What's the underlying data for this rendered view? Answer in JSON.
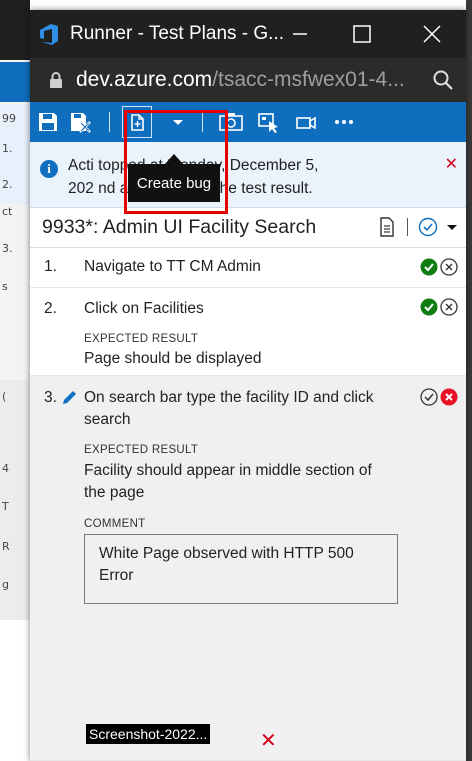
{
  "window": {
    "title": "Runner - Test Plans - G...",
    "url_host": "dev.azure.com",
    "url_path": "/tsacc-msfwex01-4..."
  },
  "toolbar": {
    "tooltip": "Create bug"
  },
  "info_bar": {
    "line1": "Acti       topped at Monday, December 5,",
    "line2": "202       nd attached with the test result."
  },
  "test_case": {
    "title": "9933*: Admin UI Facility Search"
  },
  "steps": [
    {
      "number": "1.",
      "action_line1": "Navigate to TT CM Admin",
      "status": "passed"
    },
    {
      "number": "2.",
      "action_line1": "Click on Facilities",
      "expected_label": "EXPECTED RESULT",
      "expected_line1": "Page should be displayed",
      "status": "passed"
    },
    {
      "number": "3.",
      "action_line1": "On search bar type the facility ID and click",
      "action_line2": "search",
      "expected_label": "EXPECTED RESULT",
      "expected_line1": "Facility should appear in middle section of",
      "expected_line2": "the page",
      "comment_label": "COMMENT",
      "comment_line1": "White Page observed with HTTP 500",
      "comment_line2": "Error",
      "attachment": "Screenshot-2022...",
      "status": "failed"
    }
  ],
  "background_window": {
    "rows": [
      "99",
      "1.",
      "2.",
      "ct",
      "3.",
      "s",
      "(",
      "4",
      "T",
      "R",
      "g"
    ]
  },
  "colors": {
    "accent": "#106ebe",
    "pass": "#107c10",
    "fail": "#e81123",
    "highlight": "#e60000"
  }
}
